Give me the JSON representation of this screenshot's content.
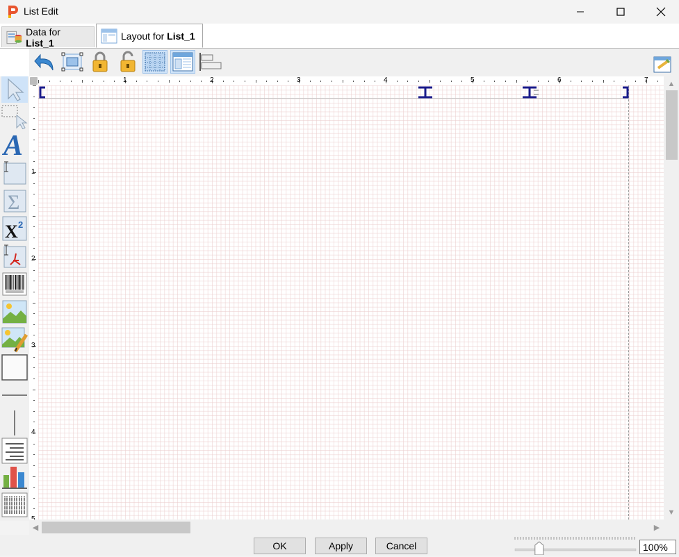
{
  "window": {
    "title": "List Edit"
  },
  "tabs": [
    {
      "prefix": "Data for ",
      "bold": "List_1",
      "active": false
    },
    {
      "prefix": "Layout for ",
      "bold": "List_1",
      "active": true
    }
  ],
  "ruler": {
    "top_labels": [
      "1",
      "2",
      "3",
      "4",
      "5",
      "6",
      "7"
    ],
    "left_labels": [
      "1",
      "2",
      "3",
      "4",
      "5"
    ]
  },
  "buttons": {
    "ok": "OK",
    "apply": "Apply",
    "cancel": "Cancel"
  },
  "zoom": {
    "value": "100%",
    "level": 0.2
  },
  "toolbar": {
    "icons": [
      "undo-icon",
      "group-objects-icon",
      "lock-icon",
      "unlock-icon",
      "snap-to-grid-icon",
      "show-grid-icon",
      "align-left-icon"
    ],
    "right_icon": "page-setup-icon"
  },
  "palette": {
    "icons": [
      "pointer-tool-icon",
      "marquee-select-icon",
      "text-tool-icon",
      "field-tool-icon",
      "sum-tool-icon",
      "superscript-tool-icon",
      "pdf-field-icon",
      "barcode-tool-icon",
      "image-tool-icon",
      "image-field-icon",
      "rectangle-tool-icon",
      "horizontal-line-icon",
      "vertical-line-icon",
      "paragraph-tool-icon",
      "chart-tool-icon",
      "table-tool-icon"
    ]
  },
  "colors": {
    "accent": "#cfe3f8",
    "handle": "#1a1a8a"
  }
}
